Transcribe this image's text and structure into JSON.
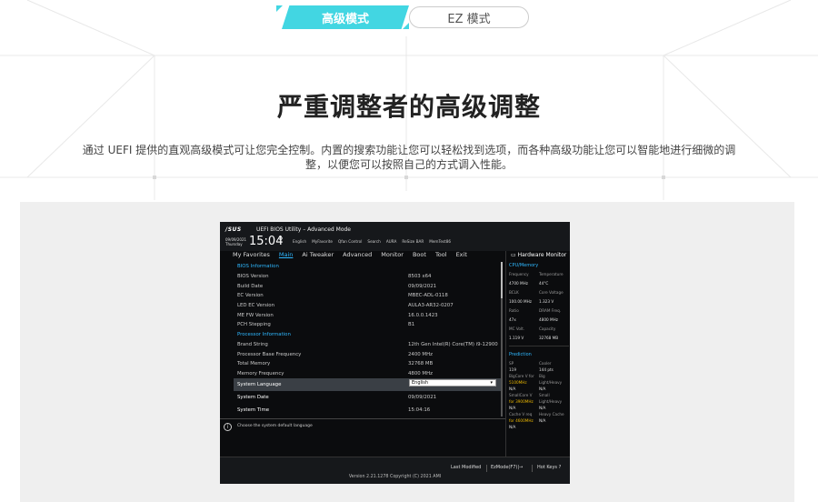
{
  "tabs": {
    "active": "高级模式",
    "other": "EZ 模式"
  },
  "title": "严重调整者的高级调整",
  "description": "通过 UEFI 提供的直观高级模式可让您完全控制。内置的搜索功能让您可以轻松找到选项，而各种高级功能让您可以智能地进行细微的调整，以便您可以按照自己的方式调入性能。",
  "bios": {
    "logo": "/SUS",
    "title": "UEFI BIOS Utility – Advanced Mode",
    "date": "09/09/2021",
    "weekday": "Thursday",
    "time": "15:04",
    "toolbar": [
      "English",
      "MyFavorite",
      "Qfan Control",
      "Search",
      "AURA",
      "ReSize BAR",
      "MemTest86"
    ],
    "menu": [
      "My Favorites",
      "Main",
      "Ai Tweaker",
      "Advanced",
      "Monitor",
      "Boot",
      "Tool",
      "Exit"
    ],
    "rows": [
      {
        "k": "BIOS Information",
        "v": "",
        "type": "sec"
      },
      {
        "k": "BIOS Version",
        "v": "8503  x64",
        "type": "n"
      },
      {
        "k": "Build Date",
        "v": "09/09/2021",
        "type": "n"
      },
      {
        "k": "EC Version",
        "v": "MBEC-ADL-0118",
        "type": "n"
      },
      {
        "k": "LED EC Version",
        "v": "AULA3-AR32-0207",
        "type": "n"
      },
      {
        "k": "ME FW Version",
        "v": "16.0.0.1423",
        "type": "n"
      },
      {
        "k": "PCH Stepping",
        "v": "B1",
        "type": "n"
      },
      {
        "k": "Processor Information",
        "v": "",
        "type": "sec"
      },
      {
        "k": "Brand String",
        "v": "12th Gen Intel(R) Core(TM) i9-12900",
        "type": "n"
      },
      {
        "k": "Processor Base Frequency",
        "v": "2400 MHz",
        "type": "n"
      },
      {
        "k": "Total Memory",
        "v": "32768 MB",
        "type": "n"
      },
      {
        "k": "Memory Frequency",
        "v": "4800 MHz",
        "type": "n"
      }
    ],
    "language": {
      "label": "System Language",
      "value": "English"
    },
    "sysdate": {
      "label": "System Date",
      "value": "09/09/2021"
    },
    "systime": {
      "label": "System Time",
      "value": "15:04:16"
    },
    "help": "Choose the system default language",
    "hw": {
      "title": "Hardware Monitor",
      "sec1": "CPU/Memory",
      "grid1": [
        [
          "Frequency",
          "Temperature"
        ],
        [
          "4700 MHz",
          "44°C"
        ],
        [
          "BCLK",
          "Core Voltage"
        ],
        [
          "100.00 MHz",
          "1.323 V"
        ],
        [
          "Ratio",
          "DRAM Freq."
        ],
        [
          "47x",
          "4800 MHz"
        ],
        [
          "MC Volt.",
          "Capacity"
        ],
        [
          "1.119 V",
          "32768 MB"
        ]
      ],
      "sec2": "Prediction",
      "grid2": [
        [
          "SP",
          "Cooler"
        ],
        [
          "119",
          "144 pts"
        ],
        [
          "BigCore V for",
          "Big"
        ],
        [
          "5100MHz",
          "Light/Heavy"
        ],
        [
          "N/A",
          "N/A"
        ],
        [
          "SmallCore V",
          "Small"
        ],
        [
          "for 3900MHz",
          "Light/Heavy"
        ],
        [
          "N/A",
          "N/A"
        ],
        [
          "Cache V req",
          "Heavy Cache"
        ],
        [
          "for 4600MHz",
          "N/A"
        ],
        [
          "N/A",
          ""
        ]
      ]
    },
    "footer": {
      "last": "Last Modified",
      "ez": "EzMode(F7)|→",
      "hot": "Hot Keys ?",
      "version": "Version 2.21.1278 Copyright (C) 2021 AMI"
    }
  }
}
